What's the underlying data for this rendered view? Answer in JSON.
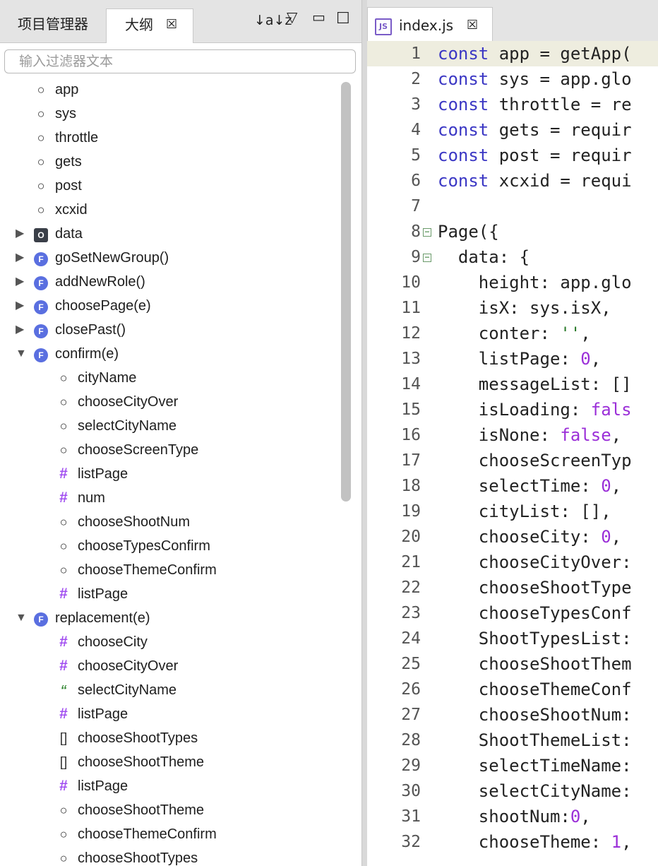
{
  "left_panel": {
    "tabs": {
      "project": "项目管理器",
      "outline": "大纲",
      "outline_close": "☒"
    },
    "toolbar": {
      "sort": "↓a↓z",
      "menu": "▽",
      "minimize": "▭",
      "maximize": "☐"
    },
    "filter_placeholder": "输入过滤器文本",
    "items": [
      {
        "label": "app",
        "icon": "field",
        "depth": 0,
        "arrow": ""
      },
      {
        "label": "sys",
        "icon": "field",
        "depth": 0,
        "arrow": ""
      },
      {
        "label": "throttle",
        "icon": "field",
        "depth": 0,
        "arrow": ""
      },
      {
        "label": "gets",
        "icon": "field",
        "depth": 0,
        "arrow": ""
      },
      {
        "label": "post",
        "icon": "field",
        "depth": 0,
        "arrow": ""
      },
      {
        "label": "xcxid",
        "icon": "field",
        "depth": 0,
        "arrow": ""
      },
      {
        "label": "data",
        "icon": "object",
        "depth": 0,
        "arrow": "collapsed"
      },
      {
        "label": "goSetNewGroup()",
        "icon": "function",
        "depth": 0,
        "arrow": "collapsed"
      },
      {
        "label": "addNewRole()",
        "icon": "function",
        "depth": 0,
        "arrow": "collapsed"
      },
      {
        "label": "choosePage(e)",
        "icon": "function",
        "depth": 0,
        "arrow": "collapsed"
      },
      {
        "label": "closePast()",
        "icon": "function",
        "depth": 0,
        "arrow": "collapsed"
      },
      {
        "label": "confirm(e)",
        "icon": "function",
        "depth": 0,
        "arrow": "expanded"
      },
      {
        "label": "cityName",
        "icon": "field",
        "depth": 1,
        "arrow": ""
      },
      {
        "label": "chooseCityOver",
        "icon": "field",
        "depth": 1,
        "arrow": ""
      },
      {
        "label": "selectCityName",
        "icon": "field",
        "depth": 1,
        "arrow": ""
      },
      {
        "label": "chooseScreenType",
        "icon": "field",
        "depth": 1,
        "arrow": ""
      },
      {
        "label": "listPage",
        "icon": "number",
        "depth": 1,
        "arrow": ""
      },
      {
        "label": "num",
        "icon": "number",
        "depth": 1,
        "arrow": ""
      },
      {
        "label": "chooseShootNum",
        "icon": "field",
        "depth": 1,
        "arrow": ""
      },
      {
        "label": "chooseTypesConfirm",
        "icon": "field",
        "depth": 1,
        "arrow": ""
      },
      {
        "label": "chooseThemeConfirm",
        "icon": "field",
        "depth": 1,
        "arrow": ""
      },
      {
        "label": "listPage",
        "icon": "number",
        "depth": 1,
        "arrow": ""
      },
      {
        "label": "replacement(e)",
        "icon": "function",
        "depth": 0,
        "arrow": "expanded"
      },
      {
        "label": "chooseCity",
        "icon": "number",
        "depth": 1,
        "arrow": ""
      },
      {
        "label": "chooseCityOver",
        "icon": "number",
        "depth": 1,
        "arrow": ""
      },
      {
        "label": "selectCityName",
        "icon": "string",
        "depth": 1,
        "arrow": ""
      },
      {
        "label": "listPage",
        "icon": "number",
        "depth": 1,
        "arrow": ""
      },
      {
        "label": "chooseShootTypes",
        "icon": "array",
        "depth": 1,
        "arrow": ""
      },
      {
        "label": "chooseShootTheme",
        "icon": "array",
        "depth": 1,
        "arrow": ""
      },
      {
        "label": "listPage",
        "icon": "number",
        "depth": 1,
        "arrow": ""
      },
      {
        "label": "chooseShootTheme",
        "icon": "field",
        "depth": 1,
        "arrow": ""
      },
      {
        "label": "chooseThemeConfirm",
        "icon": "field",
        "depth": 1,
        "arrow": ""
      },
      {
        "label": "chooseShootTypes",
        "icon": "field",
        "depth": 1,
        "arrow": ""
      }
    ]
  },
  "editor": {
    "tab": {
      "icon_text": "JS",
      "label": "index.js",
      "close": "☒"
    },
    "lines": [
      {
        "n": "1",
        "fold": false,
        "highlight": true,
        "parts": [
          [
            "kw",
            "const"
          ],
          [
            "",
            "app = getApp("
          ]
        ]
      },
      {
        "n": "2",
        "fold": false,
        "highlight": false,
        "parts": [
          [
            "kw",
            "const"
          ],
          [
            "",
            "sys = app.glo"
          ]
        ]
      },
      {
        "n": "3",
        "fold": false,
        "highlight": false,
        "parts": [
          [
            "kw",
            "const"
          ],
          [
            "",
            "throttle = re"
          ]
        ]
      },
      {
        "n": "4",
        "fold": false,
        "highlight": false,
        "parts": [
          [
            "kw",
            "const"
          ],
          [
            "",
            "gets = requir"
          ]
        ]
      },
      {
        "n": "5",
        "fold": false,
        "highlight": false,
        "parts": [
          [
            "kw",
            "const"
          ],
          [
            "",
            "post = requir"
          ]
        ]
      },
      {
        "n": "6",
        "fold": false,
        "highlight": false,
        "parts": [
          [
            "kw",
            "const"
          ],
          [
            "",
            "xcxid = requi"
          ]
        ]
      },
      {
        "n": "7",
        "fold": false,
        "highlight": false,
        "parts": []
      },
      {
        "n": "8",
        "fold": true,
        "highlight": false,
        "parts": [
          [
            "",
            "Page({"
          ]
        ]
      },
      {
        "n": "9",
        "fold": true,
        "highlight": false,
        "parts": [
          [
            "",
            "  data: {"
          ]
        ]
      },
      {
        "n": "10",
        "fold": false,
        "highlight": false,
        "parts": [
          [
            "",
            "    height: app.glo"
          ]
        ]
      },
      {
        "n": "11",
        "fold": false,
        "highlight": false,
        "parts": [
          [
            "",
            "    isX: sys.isX,"
          ]
        ]
      },
      {
        "n": "12",
        "fold": false,
        "highlight": false,
        "parts": [
          [
            "",
            "    conter: "
          ],
          [
            "str",
            "''"
          ],
          [
            "",
            ","
          ]
        ]
      },
      {
        "n": "13",
        "fold": false,
        "highlight": false,
        "parts": [
          [
            "",
            "    listPage: "
          ],
          [
            "purple",
            "0"
          ],
          [
            "",
            ","
          ]
        ]
      },
      {
        "n": "14",
        "fold": false,
        "highlight": false,
        "parts": [
          [
            "",
            "    messageList: []"
          ]
        ]
      },
      {
        "n": "15",
        "fold": false,
        "highlight": false,
        "parts": [
          [
            "",
            "    isLoading: "
          ],
          [
            "purple",
            "fals"
          ]
        ]
      },
      {
        "n": "16",
        "fold": false,
        "highlight": false,
        "parts": [
          [
            "",
            "    isNone: "
          ],
          [
            "purple",
            "false"
          ],
          [
            "",
            ","
          ]
        ]
      },
      {
        "n": "17",
        "fold": false,
        "highlight": false,
        "parts": [
          [
            "",
            "    chooseScreenTyp"
          ]
        ]
      },
      {
        "n": "18",
        "fold": false,
        "highlight": false,
        "parts": [
          [
            "",
            "    selectTime: "
          ],
          [
            "purple",
            "0"
          ],
          [
            "",
            ","
          ]
        ]
      },
      {
        "n": "19",
        "fold": false,
        "highlight": false,
        "parts": [
          [
            "",
            "    cityList: [],"
          ]
        ]
      },
      {
        "n": "20",
        "fold": false,
        "highlight": false,
        "parts": [
          [
            "",
            "    chooseCity: "
          ],
          [
            "purple",
            "0"
          ],
          [
            "",
            ","
          ]
        ]
      },
      {
        "n": "21",
        "fold": false,
        "highlight": false,
        "parts": [
          [
            "",
            "    chooseCityOver:"
          ]
        ]
      },
      {
        "n": "22",
        "fold": false,
        "highlight": false,
        "parts": [
          [
            "",
            "    chooseShootType"
          ]
        ]
      },
      {
        "n": "23",
        "fold": false,
        "highlight": false,
        "parts": [
          [
            "",
            "    chooseTypesConf"
          ]
        ]
      },
      {
        "n": "24",
        "fold": false,
        "highlight": false,
        "parts": [
          [
            "",
            "    ShootTypesList:"
          ]
        ]
      },
      {
        "n": "25",
        "fold": false,
        "highlight": false,
        "parts": [
          [
            "",
            "    chooseShootThem"
          ]
        ]
      },
      {
        "n": "26",
        "fold": false,
        "highlight": false,
        "parts": [
          [
            "",
            "    chooseThemeConf"
          ]
        ]
      },
      {
        "n": "27",
        "fold": false,
        "highlight": false,
        "parts": [
          [
            "",
            "    chooseShootNum:"
          ]
        ]
      },
      {
        "n": "28",
        "fold": false,
        "highlight": false,
        "parts": [
          [
            "",
            "    ShootThemeList:"
          ]
        ]
      },
      {
        "n": "29",
        "fold": false,
        "highlight": false,
        "parts": [
          [
            "",
            "    selectTimeName:"
          ]
        ]
      },
      {
        "n": "30",
        "fold": false,
        "highlight": false,
        "parts": [
          [
            "",
            "    selectCityName:"
          ]
        ]
      },
      {
        "n": "31",
        "fold": false,
        "highlight": false,
        "parts": [
          [
            "",
            "    shootNum:"
          ],
          [
            "purple",
            "0"
          ],
          [
            "",
            ","
          ]
        ]
      },
      {
        "n": "32",
        "fold": false,
        "highlight": false,
        "parts": [
          [
            "",
            "    chooseTheme: "
          ],
          [
            "purple",
            "1"
          ],
          [
            "",
            ","
          ]
        ]
      }
    ]
  }
}
